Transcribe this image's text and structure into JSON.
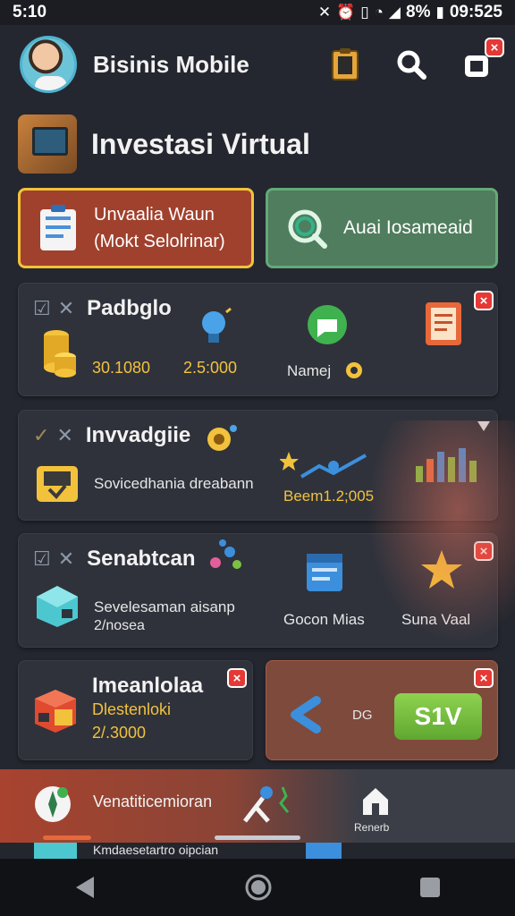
{
  "status_bar": {
    "time_left": "5:10",
    "battery": "8%",
    "time_right": "09:525"
  },
  "header": {
    "title": "Bisinis Mobile"
  },
  "section": {
    "title": "Investasi Virtual"
  },
  "actions": {
    "left_line1": "Unvaalia Waun",
    "left_line2": "(Mokt Selolrinar)",
    "right_label": "Auai Iosameaid"
  },
  "cards": {
    "c1": {
      "title": "Padbglo",
      "value1": "30.1080",
      "value2": "2.5:000",
      "label3": "Namej"
    },
    "c2": {
      "title": "Invvadgiie",
      "desc1": "Sovicedhania dreabann",
      "value": "Beem1.2;005"
    },
    "c3": {
      "title": "Senabtcan",
      "desc1": "Sevelesaman aisanp",
      "desc2": "2/nosea",
      "label2": "Gocon Mias",
      "label3": "Suna Vaal"
    },
    "c4": {
      "title": "Imeanlolaa",
      "desc1": "Dlestenloki",
      "value": "2/.3000"
    },
    "c5": {
      "prefix": "DG",
      "button": "S1V"
    }
  },
  "bottom": {
    "label": "Venatiticemioran",
    "label_right": "Renerb",
    "peek_label": "Kmdaesetartro oipcian"
  },
  "colors": {
    "accent_gold": "#f2c23c",
    "danger": "#e53935",
    "green": "#7cc242"
  }
}
